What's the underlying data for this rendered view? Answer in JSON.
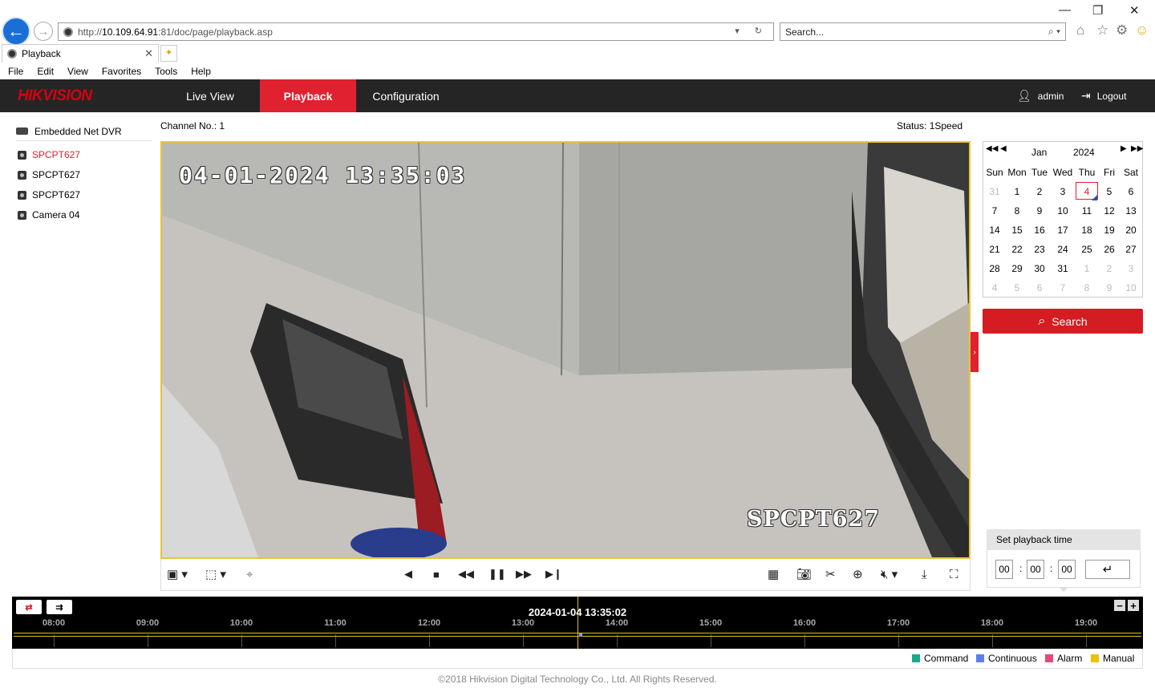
{
  "browser": {
    "url_prefix": "http://",
    "url_domain": "10.109.64.91",
    "url_path": ":81/doc/page/playback.asp",
    "search_placeholder": "Search...",
    "tab_title": "Playback",
    "menu": [
      "File",
      "Edit",
      "View",
      "Favorites",
      "Tools",
      "Help"
    ]
  },
  "app": {
    "brand": "HIKVISION",
    "nav": {
      "live": "Live View",
      "playback": "Playback",
      "config": "Configuration"
    },
    "user": "admin",
    "logout": "Logout"
  },
  "tree": {
    "root": "Embedded Net DVR",
    "cameras": [
      "SPCPT627",
      "SPCPT627",
      "SPCPT627",
      "Camera 04"
    ]
  },
  "info": {
    "channel": "Channel No.: 1",
    "status": "Status: 1Speed"
  },
  "video": {
    "osd_time": "04-01-2024 13:35:03",
    "osd_name": "SPCPT627"
  },
  "calendar": {
    "month": "Jan",
    "year": "2024",
    "weekdays": [
      "Sun",
      "Mon",
      "Tue",
      "Wed",
      "Thu",
      "Fri",
      "Sat"
    ],
    "days": [
      [
        "31",
        "1",
        "2",
        "3",
        "4",
        "5",
        "6"
      ],
      [
        "7",
        "8",
        "9",
        "10",
        "11",
        "12",
        "13"
      ],
      [
        "14",
        "15",
        "16",
        "17",
        "18",
        "19",
        "20"
      ],
      [
        "21",
        "22",
        "23",
        "24",
        "25",
        "26",
        "27"
      ],
      [
        "28",
        "29",
        "30",
        "31",
        "1",
        "2",
        "3"
      ],
      [
        "4",
        "5",
        "6",
        "7",
        "8",
        "9",
        "10"
      ]
    ],
    "selected": "4"
  },
  "search_button": "Search",
  "playback_time": {
    "title": "Set playback time",
    "hh": "00",
    "mm": "00",
    "ss": "00",
    "sep": ":"
  },
  "timeline": {
    "current": "2024-01-04 13:35:02",
    "ticks": [
      "08:00",
      "09:00",
      "10:00",
      "11:00",
      "12:00",
      "13:00",
      "14:00",
      "15:00",
      "16:00",
      "17:00",
      "18:00",
      "19:00"
    ]
  },
  "legend": [
    {
      "label": "Command",
      "color": "#1aaa8e"
    },
    {
      "label": "Continuous",
      "color": "#5a7ef0"
    },
    {
      "label": "Alarm",
      "color": "#e8467f"
    },
    {
      "label": "Manual",
      "color": "#f0c000"
    }
  ],
  "footer": "©2018 Hikvision Digital Technology Co., Ltd. All Rights Reserved."
}
